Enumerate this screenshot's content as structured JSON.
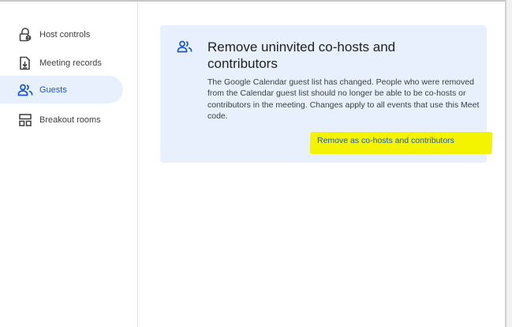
{
  "sidebar": {
    "items": [
      {
        "label": "Host controls",
        "icon": "lock-person-icon",
        "active": false
      },
      {
        "label": "Meeting records",
        "icon": "meeting-records-icon",
        "active": false
      },
      {
        "label": "Guests",
        "icon": "people-icon",
        "active": true
      },
      {
        "label": "Breakout rooms",
        "icon": "breakout-rooms-icon",
        "active": false
      }
    ]
  },
  "notice": {
    "icon": "people-icon",
    "title": "Remove uninvited co-hosts and contributors",
    "body": "The Google Calendar guest list has changed. People who were removed from the Calendar guest list should no longer be able to be co-hosts or contributors in the meeting. Changes apply to all events that use this Meet code.",
    "action_label": "Remove as co-hosts and contributors",
    "highlight_color": "#f4f400"
  },
  "colors": {
    "accent": "#1a56c9",
    "active_bg": "#e8f0fe",
    "card_bg": "#e8f0fe"
  }
}
